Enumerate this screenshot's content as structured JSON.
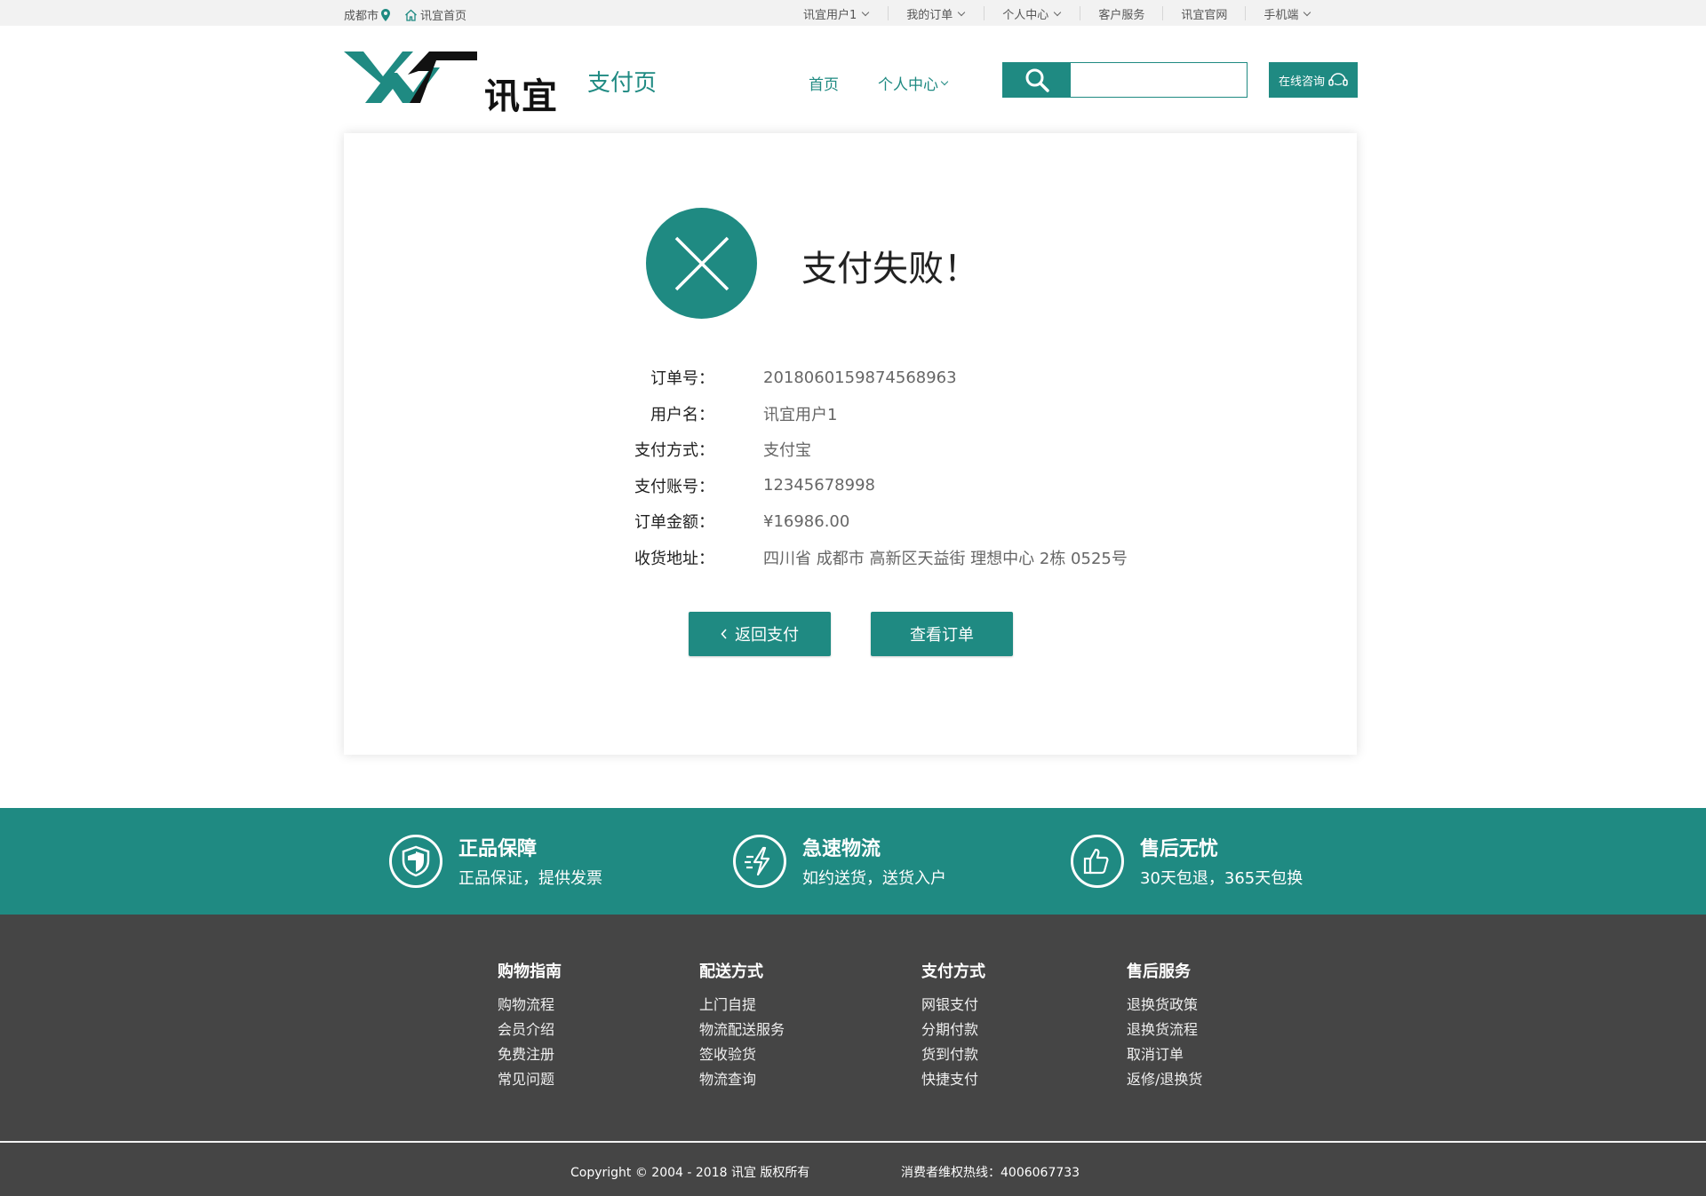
{
  "colors": {
    "accent": "#1f8a82",
    "footer_bg": "#454545",
    "topbar_bg": "#f2f2f2"
  },
  "topbar": {
    "city": "成都市",
    "home_link": "讯宜首页",
    "links": [
      "讯宜用户1",
      "我的订单",
      "个人中心",
      "客户服务",
      "讯宜官网",
      "手机端"
    ]
  },
  "header": {
    "logo_text": "讯宜",
    "page_name": "支付页",
    "nav": [
      "首页",
      "个人中心"
    ],
    "search_placeholder": "",
    "consult_label": "在线咨询"
  },
  "result": {
    "title": "支付失败！",
    "icon": "close-icon",
    "rows": [
      {
        "label": "订单号：",
        "value": "2018060159874568963"
      },
      {
        "label": "用户名：",
        "value": "讯宜用户1"
      },
      {
        "label": "支付方式：",
        "value": "支付宝"
      },
      {
        "label": "支付账号：",
        "value": "12345678998"
      },
      {
        "label": "订单金额：",
        "value": "¥16986.00"
      },
      {
        "label": "收货地址：",
        "value": "四川省 成都市 高新区天益街 理想中心 2栋 0525号"
      }
    ],
    "back_button": "返回支付",
    "view_order_button": "查看订单"
  },
  "features": [
    {
      "title": "正品保障",
      "desc": "正品保证，提供发票",
      "icon": "shield-icon"
    },
    {
      "title": "急速物流",
      "desc": "如约送货，送货入户",
      "icon": "lightning-icon"
    },
    {
      "title": "售后无忧",
      "desc": "30天包退，365天包换",
      "icon": "thumbs-up-icon"
    }
  ],
  "footer": {
    "columns": [
      {
        "heading": "购物指南",
        "links": [
          "购物流程",
          "会员介绍",
          "免费注册",
          "常见问题"
        ]
      },
      {
        "heading": "配送方式",
        "links": [
          "上门自提",
          "物流配送服务",
          "签收验货",
          "物流查询"
        ]
      },
      {
        "heading": "支付方式",
        "links": [
          "网银支付",
          "分期付款",
          "货到付款",
          "快捷支付"
        ]
      },
      {
        "heading": "售后服务",
        "links": [
          "退换货政策",
          "退换货流程",
          "取消订单",
          "返修/退换货"
        ]
      }
    ],
    "copyright": "Copyright © 2004 - 2018  讯宜 版权所有",
    "hotline": "消费者维权热线：4006067733"
  }
}
